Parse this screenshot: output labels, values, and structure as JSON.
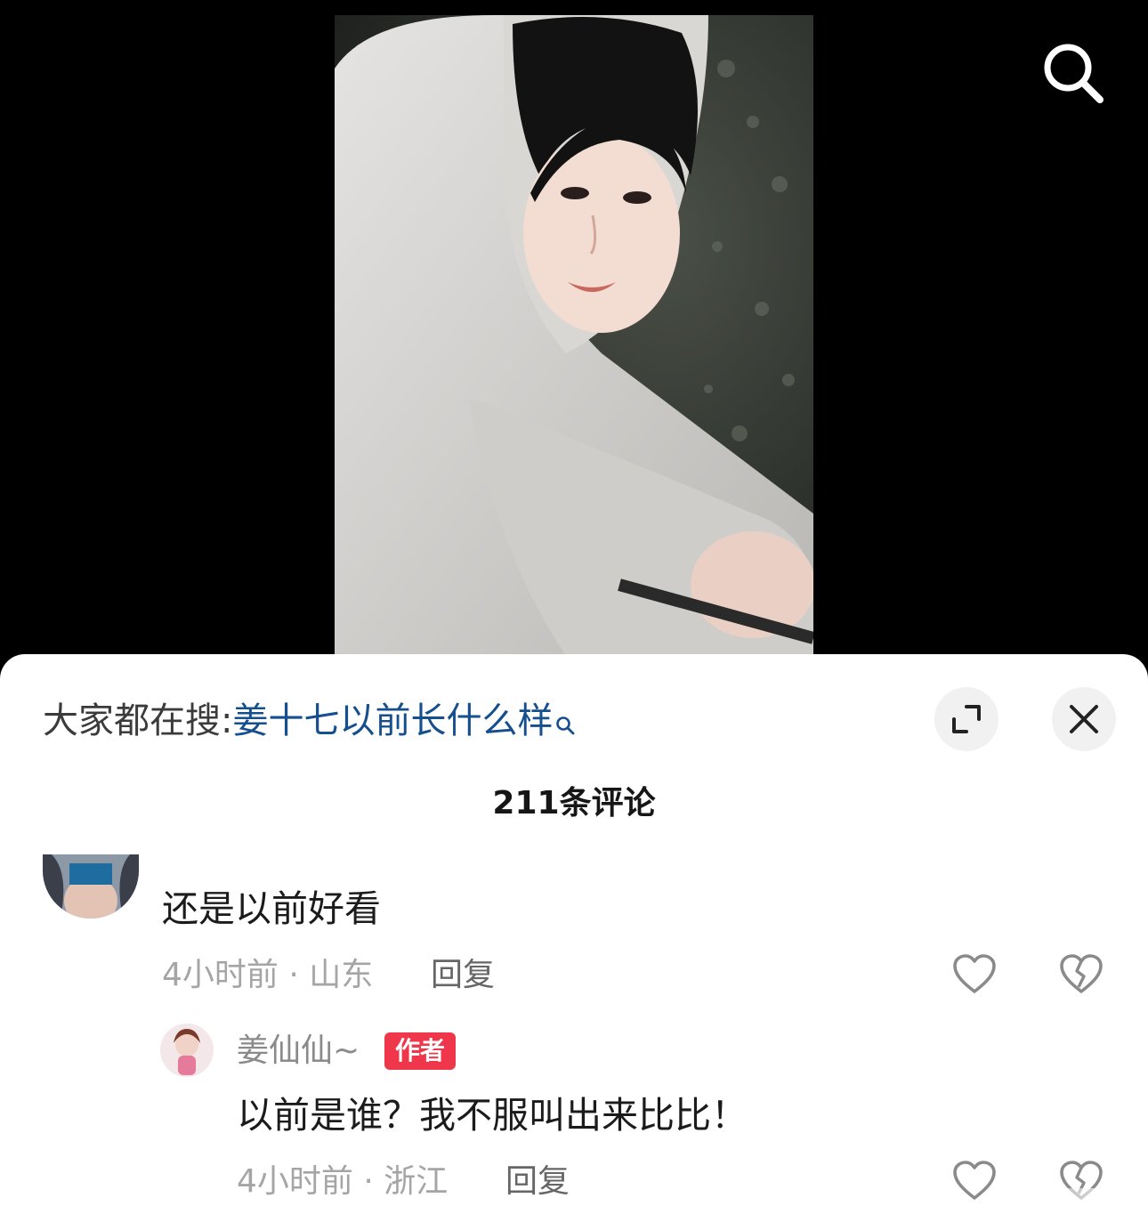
{
  "hot_search": {
    "prefix": "大家都在搜:",
    "query": "姜十七以前长什么样"
  },
  "comments_count": "211条评论",
  "comments": [
    {
      "text": "还是以前好看",
      "meta": "4小时前 · 山东",
      "reply_label": "回复"
    },
    {
      "author": "姜仙仙~",
      "badge": "作者",
      "text": "以前是谁？我不服叫出来比比！",
      "meta": "4小时前 · 浙江",
      "reply_label": "回复"
    }
  ],
  "colors": {
    "query_link": "#164f8e",
    "author_badge": "#f0364a",
    "meta_text": "#a5a5a5"
  },
  "icons": [
    "search-icon",
    "magnifier-small-icon",
    "expand-icon",
    "close-icon",
    "heart-icon",
    "broken-heart-icon"
  ]
}
